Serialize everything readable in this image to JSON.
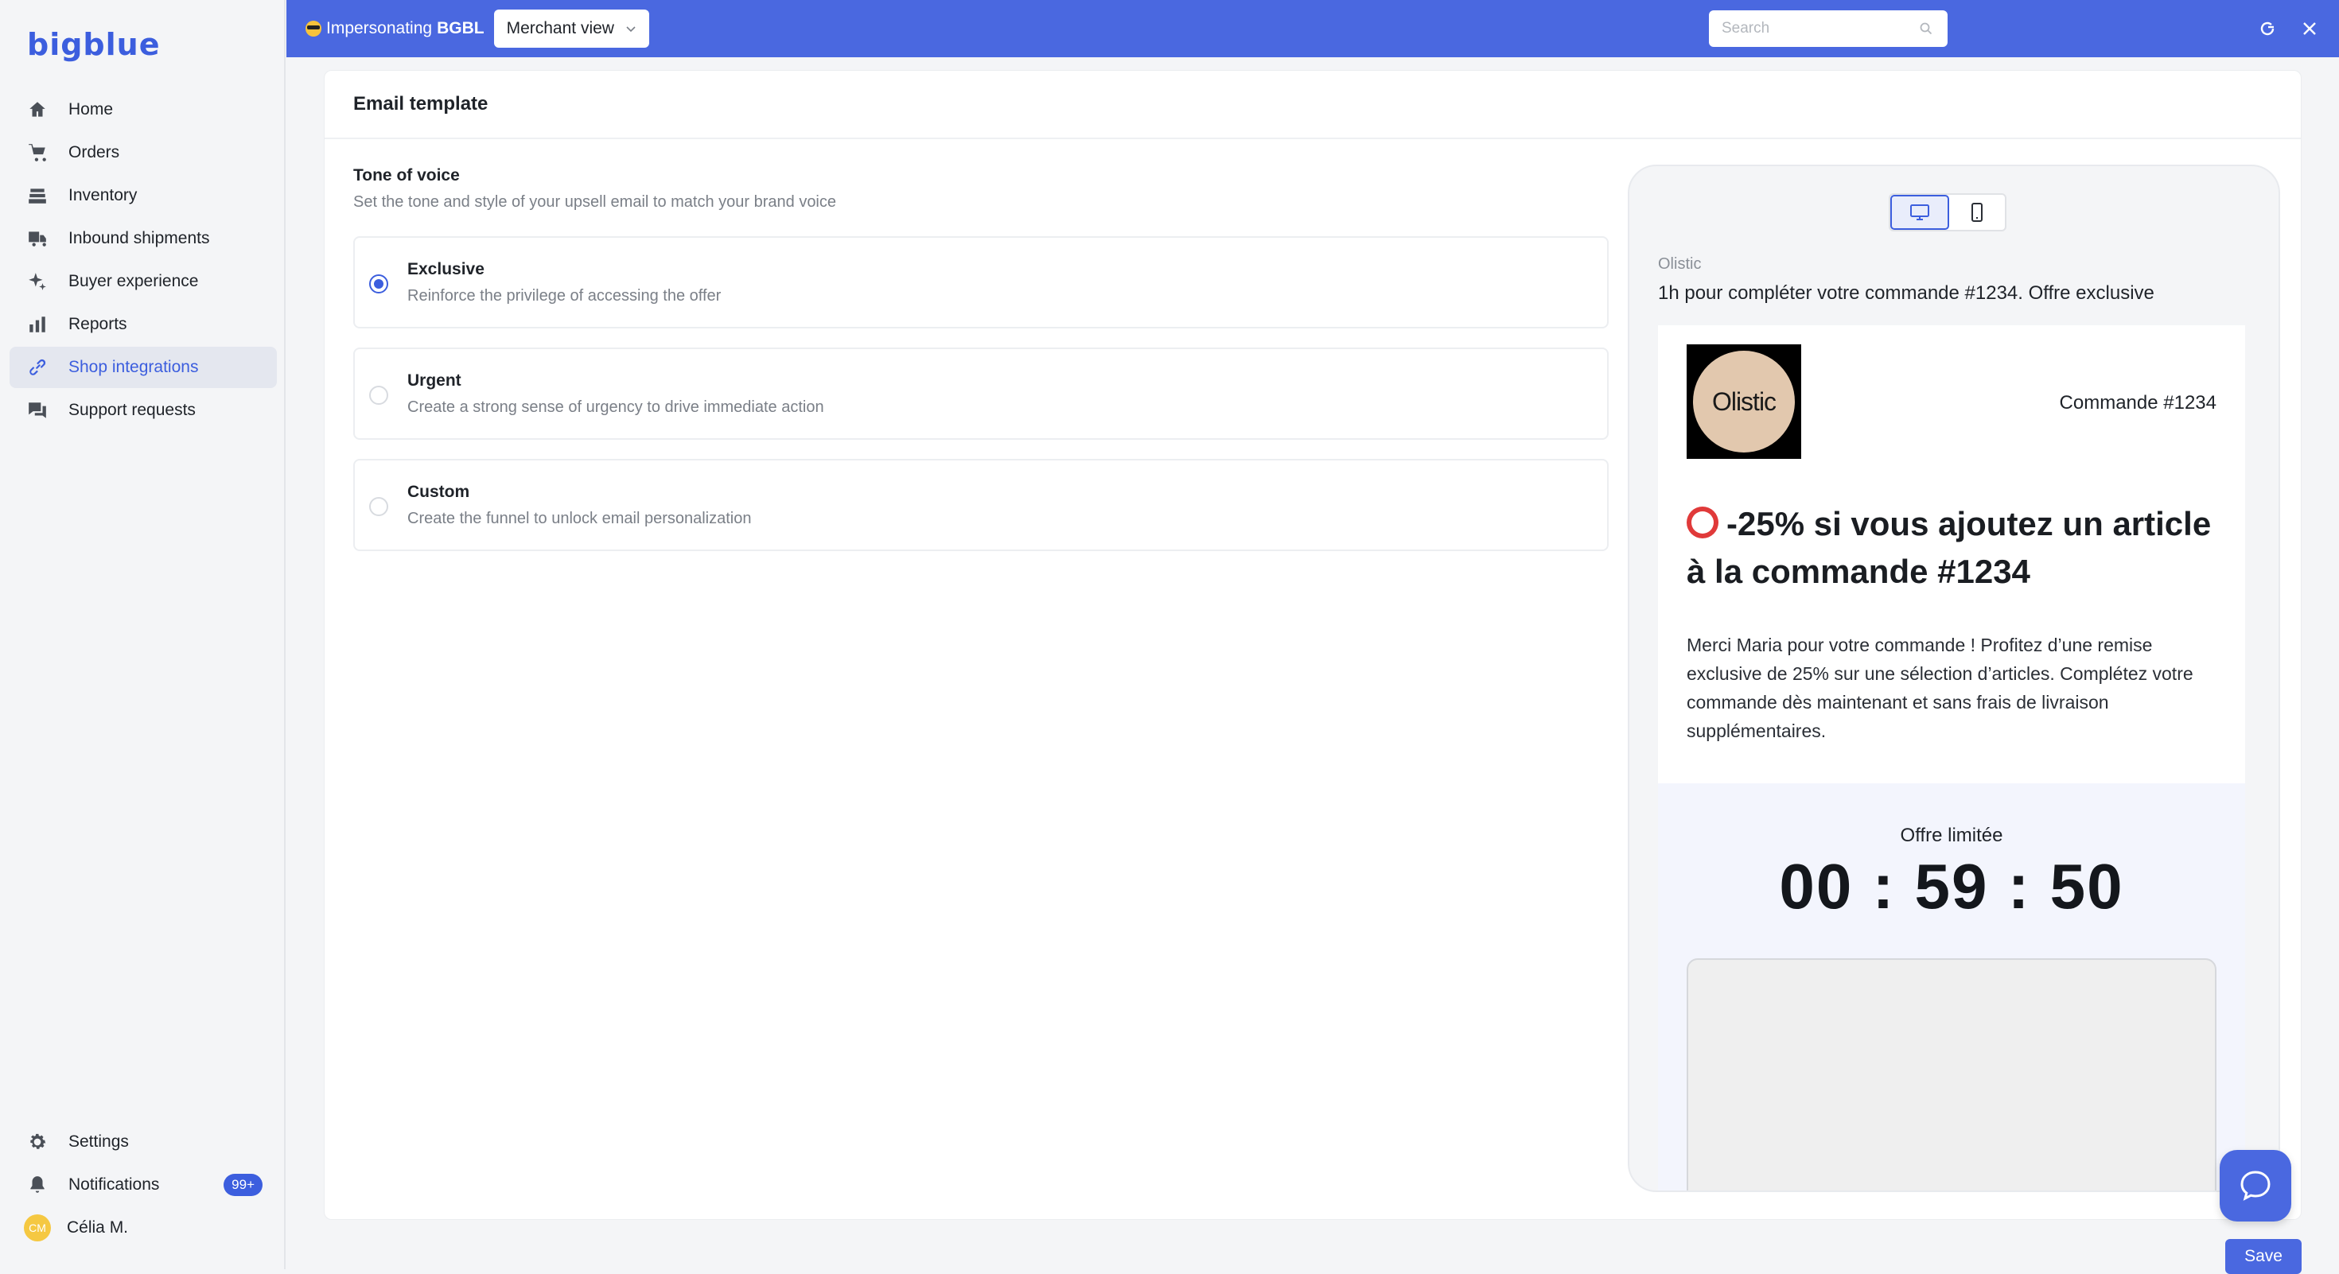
{
  "brand": {
    "logo_text": "bigblue",
    "accent": "#4a68e0"
  },
  "topbar": {
    "impersonating_label": "Impersonating",
    "impersonating_target": "BGBL",
    "view_select": "Merchant view",
    "search_placeholder": "Search"
  },
  "sidebar": {
    "items": [
      {
        "label": "Home",
        "icon": "home-icon"
      },
      {
        "label": "Orders",
        "icon": "cart-icon"
      },
      {
        "label": "Inventory",
        "icon": "inventory-icon"
      },
      {
        "label": "Inbound shipments",
        "icon": "truck-icon"
      },
      {
        "label": "Buyer experience",
        "icon": "sparkle-icon"
      },
      {
        "label": "Reports",
        "icon": "bar-chart-icon"
      },
      {
        "label": "Shop integrations",
        "icon": "link-icon",
        "active": true
      },
      {
        "label": "Support requests",
        "icon": "chat-icon"
      }
    ],
    "bottom": {
      "settings": "Settings",
      "notifications": "Notifications",
      "notifications_badge": "99+",
      "user_initials": "CM",
      "user_name": "Célia M."
    }
  },
  "main": {
    "title": "Email template",
    "tone": {
      "title": "Tone of voice",
      "subtitle": "Set the tone and style of your upsell email to match your brand voice",
      "options": [
        {
          "title": "Exclusive",
          "description": "Reinforce the privilege of accessing the offer",
          "selected": true
        },
        {
          "title": "Urgent",
          "description": "Create a strong sense of urgency to drive immediate action",
          "selected": false
        },
        {
          "title": "Custom",
          "description": "Create the funnel to unlock email personalization",
          "selected": false
        }
      ]
    },
    "preview": {
      "sender": "Olistic",
      "subject": "1h pour compléter votre commande #1234. Offre exclusive",
      "brand_logo_text": "Olistic",
      "order_number": "Commande #1234",
      "headline": "-25% si vous ajoutez un article à la commande #1234",
      "body": "Merci Maria pour votre commande ! Profitez d’une remise exclusive de 25% sur une sélection d’articles. Complétez votre commande dès maintenant et sans frais de livraison supplémentaires.",
      "offer_title": "Offre limitée",
      "countdown": "00 : 59 : 50"
    },
    "save_label": "Save"
  }
}
